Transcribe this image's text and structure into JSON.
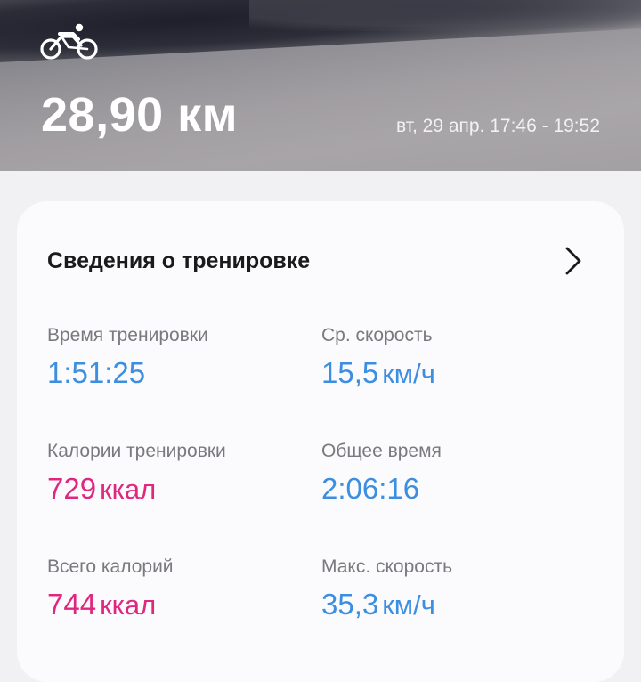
{
  "header": {
    "sport_icon": "cycling-icon",
    "distance": "28,90 км",
    "time_range": "вт, 29 апр. 17:46 - 19:52"
  },
  "details": {
    "title": "Сведения о тренировке",
    "chevron_icon": "chevron-right-icon",
    "stats": [
      {
        "label": "Время тренировки",
        "value": "1:51:25",
        "unit": "",
        "color": "#3c8ee0"
      },
      {
        "label": "Ср. скорость",
        "value": "15,5",
        "unit": "км/ч",
        "color": "#3c8ee0"
      },
      {
        "label": "Калории тренировки",
        "value": "729",
        "unit": "ккал",
        "color": "#e0277f"
      },
      {
        "label": "Общее время",
        "value": "2:06:16",
        "unit": "",
        "color": "#3c8ee0"
      },
      {
        "label": "Всего калорий",
        "value": "744",
        "unit": "ккал",
        "color": "#e0277f"
      },
      {
        "label": "Макс. скорость",
        "value": "35,3",
        "unit": "км/ч",
        "color": "#3c8ee0"
      }
    ]
  }
}
